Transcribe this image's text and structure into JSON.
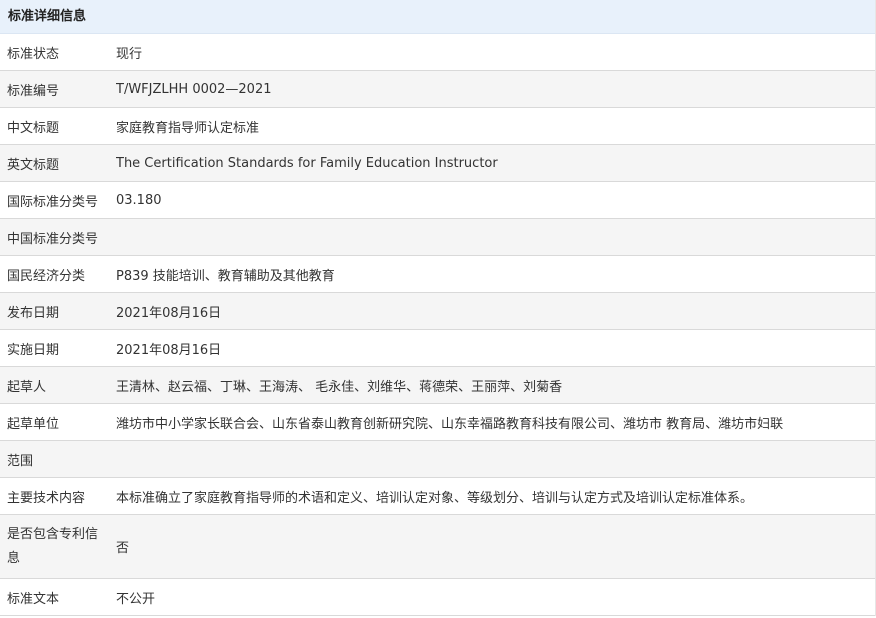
{
  "header": {
    "title": "标准详细信息"
  },
  "rows": [
    {
      "label": "标准状态",
      "value": "现行"
    },
    {
      "label": "标准编号",
      "value": "T/WFJZLHH 0002—2021"
    },
    {
      "label": "中文标题",
      "value": "家庭教育指导师认定标准"
    },
    {
      "label": "英文标题",
      "value": "The Certification Standards for Family Education Instructor"
    },
    {
      "label": "国际标准分类号",
      "value": "03.180"
    },
    {
      "label": "中国标准分类号",
      "value": ""
    },
    {
      "label": "国民经济分类",
      "value": "P839 技能培训、教育辅助及其他教育"
    },
    {
      "label": "发布日期",
      "value": "2021年08月16日"
    },
    {
      "label": "实施日期",
      "value": "2021年08月16日"
    },
    {
      "label": "起草人",
      "value": "王清林、赵云福、丁琳、王海涛、 毛永佳、刘维华、蒋德荣、王丽萍、刘菊香"
    },
    {
      "label": "起草单位",
      "value": "潍坊市中小学家长联合会、山东省泰山教育创新研究院、山东幸福路教育科技有限公司、潍坊市 教育局、潍坊市妇联"
    },
    {
      "label": "范围",
      "value": ""
    },
    {
      "label": "主要技术内容",
      "value": "本标准确立了家庭教育指导师的术语和定义、培训认定对象、等级划分、培训与认定方式及培训认定标准体系。"
    },
    {
      "label": "是否包含专利信息",
      "value": "否"
    },
    {
      "label": "标准文本",
      "value": "不公开"
    }
  ]
}
